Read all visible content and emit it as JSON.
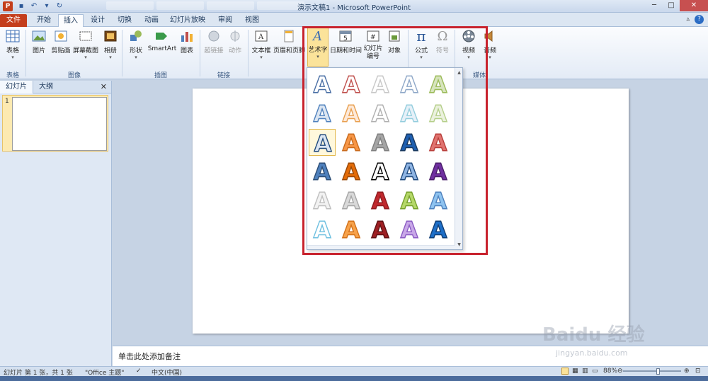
{
  "window": {
    "title": "演示文稿1 - Microsoft PowerPoint",
    "app_icon": "P"
  },
  "tabs": [
    {
      "label": "文件",
      "id": "file"
    },
    {
      "label": "开始",
      "id": "home"
    },
    {
      "label": "插入",
      "id": "insert",
      "active": true
    },
    {
      "label": "设计",
      "id": "design"
    },
    {
      "label": "切换",
      "id": "transitions"
    },
    {
      "label": "动画",
      "id": "animations"
    },
    {
      "label": "幻灯片放映",
      "id": "slideshow"
    },
    {
      "label": "审阅",
      "id": "review"
    },
    {
      "label": "视图",
      "id": "view"
    }
  ],
  "ribbon": {
    "table": "表格",
    "picture": "图片",
    "clipart": "剪贴画",
    "screenshot": "屏幕截图",
    "album": "相册",
    "shapes": "形状",
    "smartart": "SmartArt",
    "chart": "图表",
    "hyperlink": "超链接",
    "action": "动作",
    "textbox": "文本框",
    "header_footer": "页眉和页脚",
    "wordart": "艺术字",
    "datetime": "日期和时间",
    "slide_number": "幻灯片编号",
    "object": "对象",
    "equation": "公式",
    "symbol": "符号",
    "video": "视频",
    "audio": "音频"
  },
  "groups": {
    "tables": "表格",
    "images": "图像",
    "illustrations": "插图",
    "links": "链接",
    "media": "媒体"
  },
  "left_panel": {
    "tab_slides": "幻灯片",
    "tab_outline": "大纲",
    "slide_number": "1"
  },
  "notes_placeholder": "单击此处添加备注",
  "status": {
    "slide_info": "幻灯片 第 1 张，共 1 张",
    "theme": "\"Office 主题\"",
    "language": "中文(中国)",
    "zoom": "88%"
  },
  "wordart_styles": [
    {
      "fill": "#ffffff",
      "stroke": "#4a6fa5"
    },
    {
      "fill": "#ffffff",
      "stroke": "#c0504d"
    },
    {
      "fill": "#ffffff",
      "stroke": "#c8c8c8"
    },
    {
      "fill": "#ffffff",
      "stroke": "#8fa8c8"
    },
    {
      "fill": "#d7e4bd",
      "stroke": "#9bbb59"
    },
    {
      "fill": "#dbe5f1",
      "stroke": "#4f81bd"
    },
    {
      "fill": "#fde9d9",
      "stroke": "#e8a050"
    },
    {
      "fill": "#ffffff",
      "stroke": "#b0b0b0"
    },
    {
      "fill": "#e6f0f8",
      "stroke": "#93cddd"
    },
    {
      "fill": "#ebf1de",
      "stroke": "#b5cf8a"
    },
    {
      "fill": "#dbe5f1",
      "stroke": "#1f497d"
    },
    {
      "fill": "#f79646",
      "stroke": "#c86a1c"
    },
    {
      "fill": "#a5a5a5",
      "stroke": "#7f7f7f"
    },
    {
      "fill": "#1f5fb0",
      "stroke": "#17375e"
    },
    {
      "fill": "#e0736f",
      "stroke": "#b83e3a"
    },
    {
      "fill": "#4f81bd",
      "stroke": "#2c4d75"
    },
    {
      "fill": "#e36c09",
      "stroke": "#984807"
    },
    {
      "fill": "#ffffff",
      "stroke": "#000000"
    },
    {
      "fill": "#8eb4e3",
      "stroke": "#1f497d"
    },
    {
      "fill": "#7030a0",
      "stroke": "#4b1f6a"
    },
    {
      "fill": "#f2f2f2",
      "stroke": "#bfbfbf"
    },
    {
      "fill": "#d9d9d9",
      "stroke": "#a6a6a6"
    },
    {
      "fill": "#c0282d",
      "stroke": "#8e1c20"
    },
    {
      "fill": "#b5d868",
      "stroke": "#76a02b"
    },
    {
      "fill": "#8ec3f0",
      "stroke": "#4f81bd"
    },
    {
      "fill": "#ffffff",
      "stroke": "#6fc0e0"
    },
    {
      "fill": "#f7a24a",
      "stroke": "#d2711a"
    },
    {
      "fill": "#9e1f23",
      "stroke": "#5e1214"
    },
    {
      "fill": "#c9a8e8",
      "stroke": "#8b5cc4"
    },
    {
      "fill": "#1e6fc8",
      "stroke": "#123f75"
    }
  ],
  "colors": {
    "file_tab": "#c43e1c",
    "highlight": "#c8222d",
    "selected": "#fbe39a"
  }
}
